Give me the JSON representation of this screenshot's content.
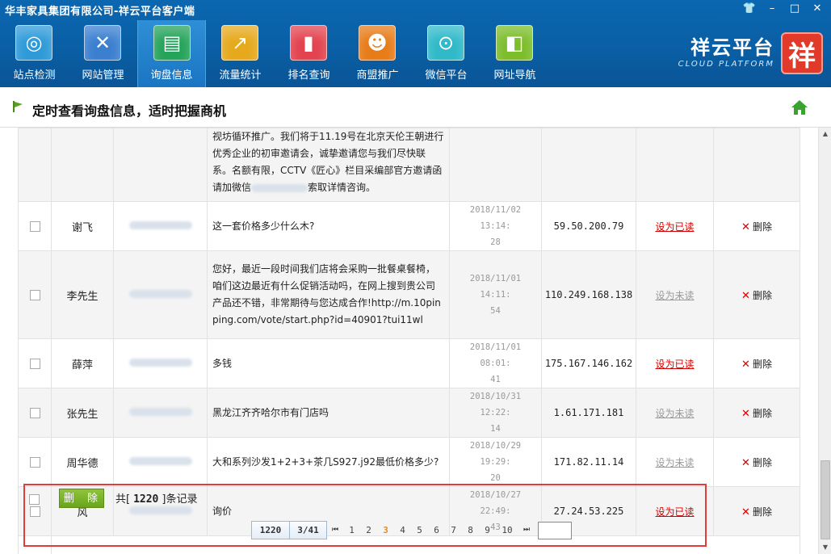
{
  "window": {
    "title": "华丰家具集团有限公司-祥云平台客户端",
    "controls": [
      {
        "icon": "shirt-icon",
        "glyph": "👕"
      },
      {
        "icon": "minimize-icon",
        "glyph": "–"
      },
      {
        "icon": "maximize-icon",
        "glyph": "□"
      },
      {
        "icon": "close-icon",
        "glyph": "✕"
      }
    ]
  },
  "toolbar": {
    "items": [
      {
        "label": "站点检测",
        "icon": "radar-icon",
        "glyph": "◎",
        "color": "#2e9ad8",
        "active": false
      },
      {
        "label": "网站管理",
        "icon": "tools-icon",
        "glyph": "✕",
        "color": "#3a7fd0",
        "active": false
      },
      {
        "label": "询盘信息",
        "icon": "chat-icon",
        "glyph": "▤",
        "color": "#24a35a",
        "active": true
      },
      {
        "label": "流量统计",
        "icon": "trend-icon",
        "glyph": "↗",
        "color": "#e6a91c",
        "active": false
      },
      {
        "label": "排名查询",
        "icon": "bar-chart-icon",
        "glyph": "▮",
        "color": "#e2434f",
        "active": false
      },
      {
        "label": "商盟推广",
        "icon": "users-icon",
        "glyph": "☻",
        "color": "#e77b18",
        "active": false
      },
      {
        "label": "微信平台",
        "icon": "wechat-icon",
        "glyph": "⊙",
        "color": "#2fb9c9",
        "active": false
      },
      {
        "label": "网址导航",
        "icon": "mouse-icon",
        "glyph": "◧",
        "color": "#7cbd2a",
        "active": false
      }
    ]
  },
  "brand": {
    "name": "祥云平台",
    "english": "CLOUD PLATFORM",
    "seal": "祥"
  },
  "heading": {
    "text": "定时查看询盘信息，适时把握商机"
  },
  "first_row_message": "视坊循环推广。我们将于11.19号在北京天伦王朝进行优秀企业的初审邀请会，诚挚邀请您与我们尽快联系。名额有限，CCTV《匠心》栏目采编部官方邀请函请加微信",
  "first_row_message_suffix": "索取详情咨询。",
  "rows": [
    {
      "name": "谢飞",
      "message": "这一套价格多少什么木?",
      "time_date": "2018/11/02 13:14:",
      "time_sec": "28",
      "ip": "59.50.200.79",
      "status": "设为已读",
      "status_kind": "unread",
      "delete": "删除"
    },
    {
      "name": "李先生",
      "message": "您好，最近一段时间我们店将会采购一批餐桌餐椅，咱们这边最近有什么促销活动吗，在网上搜到贵公司产品还不错，非常期待与您达成合作!http://m.10pinping.com/vote/start.php?id=40901?tui11wl",
      "time_date": "2018/11/01 14:11:",
      "time_sec": "54",
      "ip": "110.249.168.138",
      "status": "设为未读",
      "status_kind": "read",
      "delete": "删除"
    },
    {
      "name": "薛萍",
      "message": "多钱",
      "time_date": "2018/11/01 08:01:",
      "time_sec": "41",
      "ip": "175.167.146.162",
      "status": "设为已读",
      "status_kind": "unread",
      "delete": "删除"
    },
    {
      "name": "张先生",
      "message": "黑龙江齐齐哈尔市有门店吗",
      "time_date": "2018/10/31 12:22:",
      "time_sec": "14",
      "ip": "1.61.171.181",
      "status": "设为未读",
      "status_kind": "read",
      "delete": "删除"
    },
    {
      "name": "周华德",
      "message": "大和系列沙发1+2+3+茶几S927.j92最低价格多少?",
      "time_date": "2018/10/29 19:29:",
      "time_sec": "20",
      "ip": "171.82.11.14",
      "status": "设为未读",
      "status_kind": "read",
      "delete": "删除"
    },
    {
      "name": "风",
      "message": "询价",
      "time_date": "2018/10/27 22:49:",
      "time_sec": "43",
      "ip": "27.24.53.225",
      "status": "设为已读",
      "status_kind": "unread",
      "delete": "删除"
    }
  ],
  "footer": {
    "delete_button": "删 除",
    "total_prefix": "共[",
    "total_count": "1220",
    "total_suffix": "]条记录"
  },
  "pager": {
    "total": "1220",
    "page_of": "3/41",
    "first_glyph": "⏮",
    "last_glyph": "⏭",
    "pages": [
      "1",
      "2",
      "3",
      "4",
      "5",
      "6",
      "7",
      "8",
      "9",
      "10"
    ],
    "current": "3",
    "jump_value": ""
  }
}
